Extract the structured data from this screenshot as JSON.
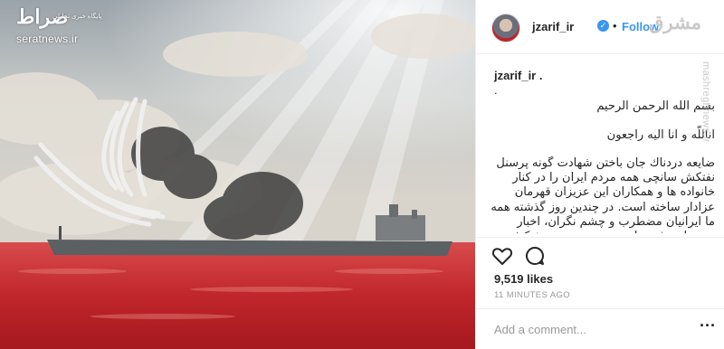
{
  "watermark": {
    "logo": "صراط",
    "sub": "پایگاه خبری تحلیلی",
    "site": "seratnews.ir"
  },
  "header": {
    "username": "jzarif_ir",
    "verified_glyph": "✓",
    "separator": "•",
    "follow": "Follow"
  },
  "caption": {
    "username": "jzarif_ir .",
    "dot": ".",
    "line1": "بسم الله الرحمن الرحيم",
    "line2": "اناللّه و انا اليه راجعون",
    "body": "ضايعه دردناك جان باختن شهادت گونه پرسنل نفتكش سانچى همه مردم ايران را در كنار خانواده ها و همكاران اين عزيزان قهرمان عزادار ساخته است. در چندين روز گذشته همه ما ايرانيان مضطرب و چشم نگران، اخبار مربوط به فرزندان محبوس خود در نفتكش سانچى را"
  },
  "meta": {
    "likes": "9,519 likes",
    "time_ago": "11 MINUTES AGO"
  },
  "comment": {
    "placeholder": "Add a comment...",
    "more": "···"
  },
  "branding": {
    "logo": "مشرق",
    "side": "mashreghnews.ir"
  },
  "icons": {
    "like": "heart-icon",
    "comment": "comment-icon",
    "verified": "verified-badge-icon"
  },
  "colors": {
    "accent": "#3897f0",
    "text": "#262626",
    "muted": "#999999",
    "sea": "#c0262b"
  }
}
